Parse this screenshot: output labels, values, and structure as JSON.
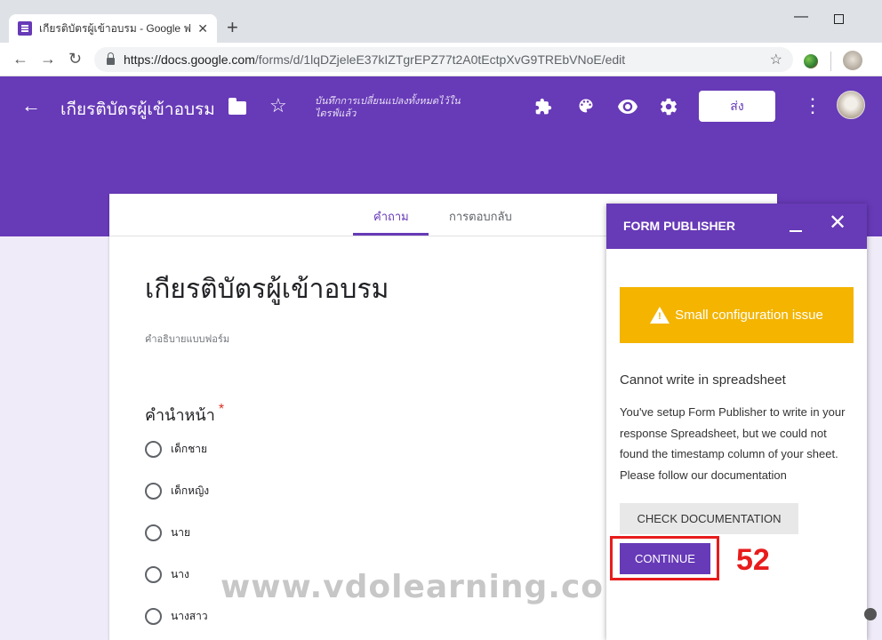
{
  "browser": {
    "tab_title": "เกียรติบัตรผู้เข้าอบรม - Google ฟอร์ม",
    "tab_close": "✕",
    "new_tab": "+",
    "win_min": "—",
    "url_domain": "https://docs.google.com",
    "url_path": "/forms/d/1lqDZjeleE37kIZTgrEPZ77t2A0tEctpXvG9TREbVNoE/edit"
  },
  "header": {
    "title": "เกียรติบัตรผู้เข้าอบรม",
    "saved_status": "บันทึกการเปลี่ยนแปลงทั้งหมดไว้ในไดรฟ์แล้ว",
    "send_label": "ส่ง",
    "accent_color": "#673ab7"
  },
  "form": {
    "tab_questions": "คำถาม",
    "tab_responses": "การตอบกลับ",
    "title": "เกียรติบัตรผู้เข้าอบรม",
    "description": "คำอธิบายแบบฟอร์ม",
    "question": "คำนำหน้า",
    "required_mark": "*",
    "options": [
      "เด็กชาย",
      "เด็กหญิง",
      "นาย",
      "นาง",
      "นางสาว"
    ]
  },
  "publisher": {
    "title": "FORM PUBLISHER",
    "close": "✕",
    "warning": "Small configuration issue",
    "warning_color": "#f4b400",
    "error_title": "Cannot write in spreadsheet",
    "error_body": "You've setup Form Publisher to write in your response Spreadsheet, but we could not found the timestamp column of your sheet. Please follow our documentation",
    "check_label": "CHECK DOCUMENTATION",
    "continue_label": "CONTINUE"
  },
  "annotation": {
    "step_number": "52",
    "watermark": "www.vdolearning.com",
    "highlight_color": "#e81c1c"
  }
}
